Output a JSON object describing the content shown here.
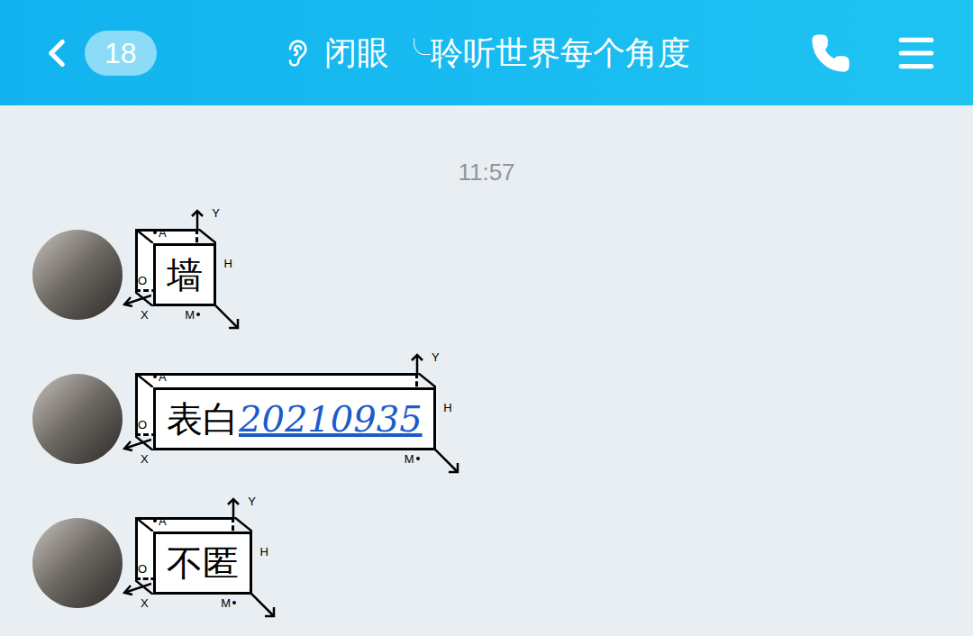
{
  "header": {
    "back_badge": "18",
    "title": "闭眼 ╰聆听世界每个角度"
  },
  "time": "11:57",
  "axis_labels": {
    "a": "A",
    "o": "O",
    "x": "X",
    "m": "M",
    "h": "H",
    "y": "Y"
  },
  "messages": [
    {
      "parts": [
        {
          "text": "墙",
          "kind": "plain"
        }
      ]
    },
    {
      "parts": [
        {
          "text": "表白",
          "kind": "plain"
        },
        {
          "text": "20210935",
          "kind": "link"
        }
      ]
    },
    {
      "parts": [
        {
          "text": "不匿",
          "kind": "plain"
        }
      ]
    }
  ]
}
